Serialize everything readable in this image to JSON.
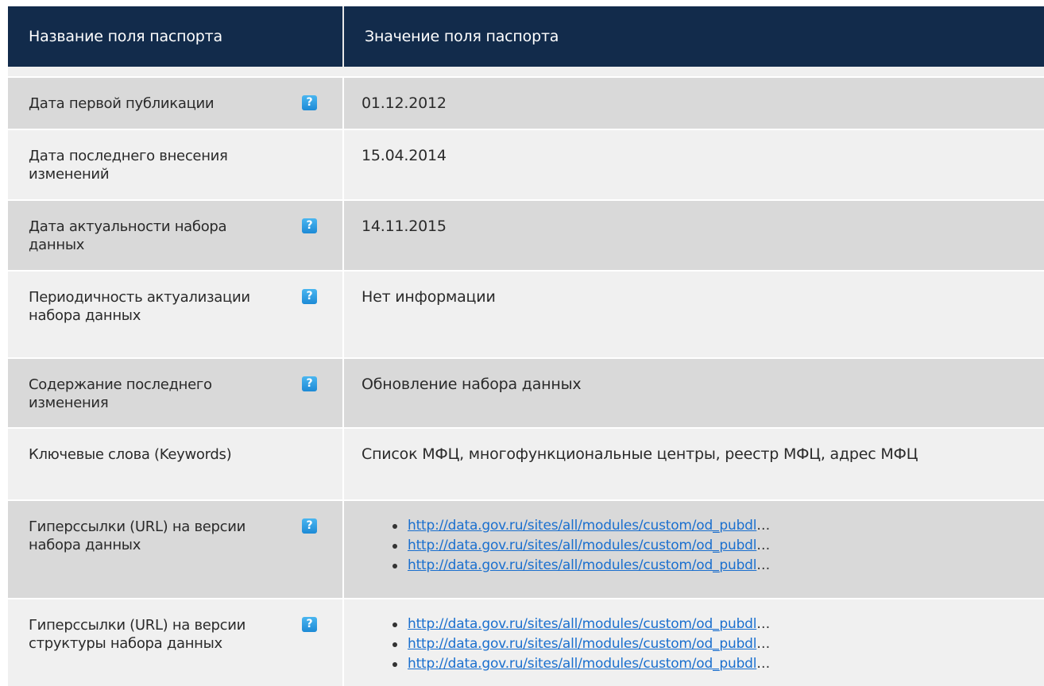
{
  "header": {
    "col_name": "Название поля паспорта",
    "col_value": "Значение поля паспорта"
  },
  "rows": [
    {
      "name": "Дата первой публикации",
      "help": "?",
      "value": "01.12.2012"
    },
    {
      "name": "Дата последнего внесения изменений",
      "help": "",
      "value": "15.04.2014"
    },
    {
      "name": "Дата актуальности набора данных",
      "help": "?",
      "value": "14.11.2015"
    },
    {
      "name": "Периодичность актуализации набора данных",
      "help": "?",
      "value": "Нет информации"
    },
    {
      "name": "Содержание последнего изменения",
      "help": "?",
      "value": "Обновление набора данных"
    },
    {
      "name": "Ключевые слова (Keywords)",
      "help": "",
      "value": "Список МФЦ, многофункциональные центры, реестр МФЦ, адрес МФЦ"
    },
    {
      "name": "Гиперссылки (URL) на версии набора данных",
      "help": "?",
      "links": [
        "http://data.gov.ru/sites/all/modules/custom/od_pubdl",
        "http://data.gov.ru/sites/all/modules/custom/od_pubdl",
        "http://data.gov.ru/sites/all/modules/custom/od_pubdl"
      ]
    },
    {
      "name": "Гиперссылки (URL) на версии структуры набора данных",
      "help": "?",
      "links": [
        "http://data.gov.ru/sites/all/modules/custom/od_pubdl",
        "http://data.gov.ru/sites/all/modules/custom/od_pubdl",
        "http://data.gov.ru/sites/all/modules/custom/od_pubdl"
      ]
    }
  ],
  "ellipsis": "…",
  "colors": {
    "header_bg": "#122b4b",
    "row_odd": "#d9d9d9",
    "row_even": "#f0f0f0",
    "help_icon": "#2a96de",
    "link": "#1a6fce"
  }
}
